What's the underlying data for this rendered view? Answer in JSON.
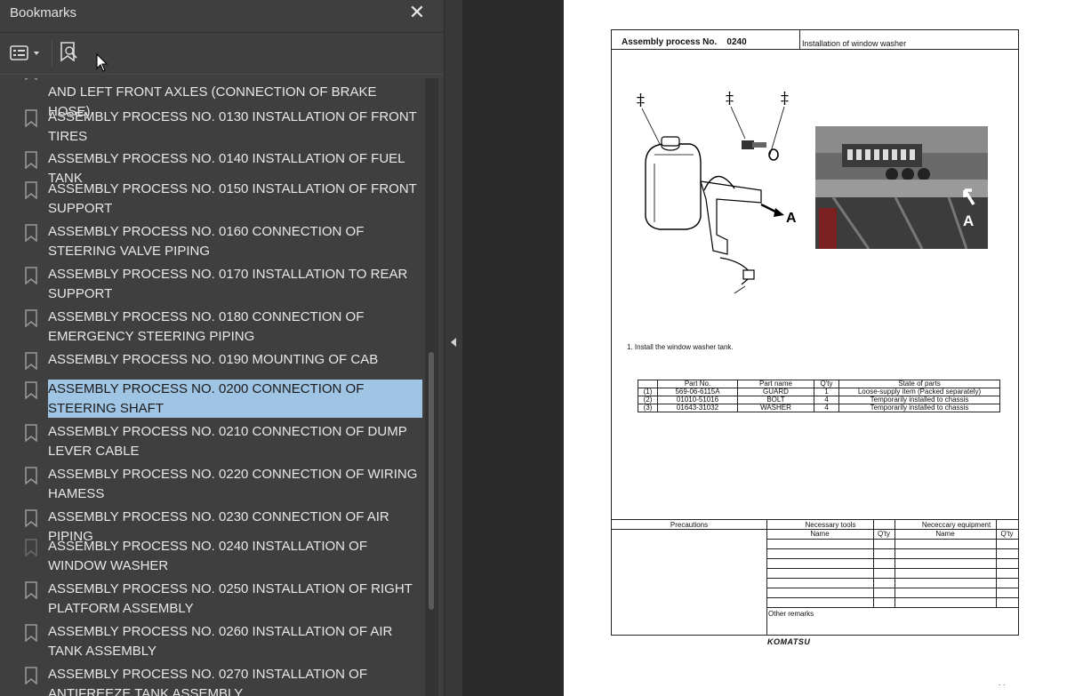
{
  "panel": {
    "title": "Bookmarks",
    "close_glyph": "✕",
    "options_icon": "bookmark-options-icon",
    "new_bookmark_icon": "new-bookmark-icon"
  },
  "bookmarks": [
    {
      "label": "AND LEFT FRONT AXLES (CONNECTION OF BRAKE HOSE)",
      "selected": false,
      "partial": true
    },
    {
      "label": "ASSEMBLY PROCESS NO. 0130 INSTALLATION OF FRONT TIRES",
      "selected": false
    },
    {
      "label": "ASSEMBLY PROCESS NO. 0140 INSTALLATION OF FUEL TANK",
      "selected": false
    },
    {
      "label": "ASSEMBLY PROCESS NO. 0150 INSTALLATION OF FRONT SUPPORT",
      "selected": false
    },
    {
      "label": "ASSEMBLY PROCESS NO. 0160 CONNECTION OF STEERING VALVE PIPING",
      "selected": false
    },
    {
      "label": "ASSEMBLY PROCESS NO. 0170 INSTALLATION TO REAR SUPPORT",
      "selected": false
    },
    {
      "label": "ASSEMBLY PROCESS NO. 0180 CONNECTION OF EMERGENCY STEERING PIPING",
      "selected": false
    },
    {
      "label": "ASSEMBLY PROCESS NO. 0190 MOUNTING OF CAB",
      "selected": false
    },
    {
      "label": "ASSEMBLY PROCESS NO. 0200 CONNECTION OF STEERING SHAFT",
      "selected": true
    },
    {
      "label": "ASSEMBLY PROCESS NO. 0210 CONNECTION OF DUMP LEVER CABLE",
      "selected": false
    },
    {
      "label": "ASSEMBLY PROCESS NO. 0220 CONNECTION OF WIRING HAMESS",
      "selected": false
    },
    {
      "label": "ASSEMBLY PROCESS NO. 0230 CONNECTION OF AIR PIPING",
      "selected": false
    },
    {
      "label": "ASSEMBLY PROCESS NO. 0240 INSTALLATION OF WINDOW WASHER",
      "selected": false
    },
    {
      "label": "ASSEMBLY PROCESS NO. 0250 INSTALLATION OF RIGHT PLATFORM ASSEMBLY",
      "selected": false
    },
    {
      "label": "ASSEMBLY PROCESS NO. 0260 INSTALLATION OF AIR TANK ASSEMBLY",
      "selected": false
    },
    {
      "label": "ASSEMBLY PROCESS NO. 0270 INSTALLATION OF ANTIFREEZE TANK ASSEMBLY",
      "selected": false
    }
  ],
  "page": {
    "header_left": "Assembly process No.    0240",
    "header_right": "Installation of window washer",
    "label_a": "A",
    "dagger": "‡",
    "instruction": "1. Install the window washer tank.",
    "parts_headers": [
      "",
      "Part No.",
      "Part name",
      "Q'ty",
      "State of parts"
    ],
    "parts_rows": [
      [
        "(1)",
        "569-06-6115A",
        "GUARD",
        "1",
        "Loose-supply item (Packed separately)"
      ],
      [
        "(2)",
        "01010-51016",
        "BOLT",
        "4",
        "Temporarily installed to chassis"
      ],
      [
        "(3)",
        "01643-31032",
        "WASHER",
        "4",
        "Temporarily installed to chassis"
      ]
    ],
    "precautions": "Precautions",
    "necessary_tools": "Necessary tools",
    "necessary_equipment": "Nececcary equipment",
    "name": "Name",
    "qty": "Q'ty",
    "other_remarks": "Other remarks",
    "logo": "KOMATSU",
    "footer_marks": ". ."
  }
}
